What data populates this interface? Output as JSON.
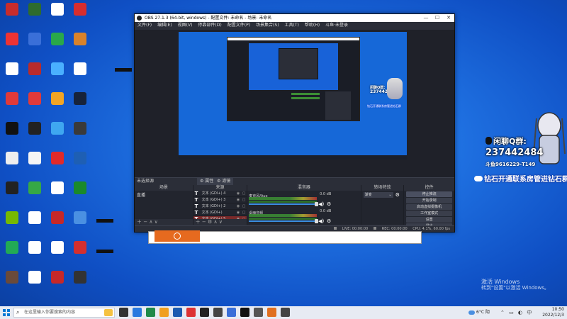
{
  "desktop": {
    "icons": [
      {
        "label": "",
        "color": "#c82c2c",
        "col": 0,
        "row": 0
      },
      {
        "label": "",
        "color": "#2e6b2e",
        "col": 1,
        "row": 0
      },
      {
        "label": "",
        "color": "#ffffff",
        "col": 2,
        "row": 0
      },
      {
        "label": "",
        "color": "#d72d2d",
        "col": 3,
        "row": 0
      },
      {
        "label": "",
        "color": "#e33",
        "col": 0,
        "row": 1
      },
      {
        "label": "",
        "color": "#3a6fd8",
        "col": 1,
        "row": 1
      },
      {
        "label": "",
        "color": "#2aa84a",
        "col": 2,
        "row": 1
      },
      {
        "label": "",
        "color": "#d9822b",
        "col": 3,
        "row": 1
      },
      {
        "label": "",
        "color": "#ffffff",
        "col": 0,
        "row": 2
      },
      {
        "label": "",
        "color": "#b92b2b",
        "col": 1,
        "row": 2
      },
      {
        "label": "",
        "color": "#4ab0ff",
        "col": 2,
        "row": 2
      },
      {
        "label": "",
        "color": "#ffffff",
        "col": 3,
        "row": 2
      },
      {
        "label": "",
        "color": "#e03a3a",
        "col": 0,
        "row": 3
      },
      {
        "label": "",
        "color": "#e03a3a",
        "col": 1,
        "row": 3
      },
      {
        "label": "",
        "color": "#f2a524",
        "col": 2,
        "row": 3
      },
      {
        "label": "",
        "color": "#17233a",
        "col": 3,
        "row": 3
      },
      {
        "label": "",
        "color": "#111111",
        "col": 0,
        "row": 4
      },
      {
        "label": "",
        "color": "#222222",
        "col": 1,
        "row": 4
      },
      {
        "label": "",
        "color": "#3fa7f0",
        "col": 2,
        "row": 4
      },
      {
        "label": "",
        "color": "#3a3a3a",
        "col": 3,
        "row": 4
      },
      {
        "label": "",
        "color": "#eeeeee",
        "col": 0,
        "row": 5
      },
      {
        "label": "",
        "color": "#f5f5f5",
        "col": 1,
        "row": 5
      },
      {
        "label": "",
        "color": "#e02a2a",
        "col": 2,
        "row": 5
      },
      {
        "label": "",
        "color": "#1e5fb4",
        "col": 3,
        "row": 5
      },
      {
        "label": "",
        "color": "#222222",
        "col": 0,
        "row": 6
      },
      {
        "label": "",
        "color": "#36a845",
        "col": 1,
        "row": 6
      },
      {
        "label": "",
        "color": "#ffffff",
        "col": 2,
        "row": 6
      },
      {
        "label": "",
        "color": "#1a8a2a",
        "col": 3,
        "row": 6
      },
      {
        "label": "",
        "color": "#76b900",
        "col": 0,
        "row": 7
      },
      {
        "label": "",
        "color": "#ffffff",
        "col": 1,
        "row": 7
      },
      {
        "label": "",
        "color": "#c62828",
        "col": 2,
        "row": 7
      },
      {
        "label": "",
        "color": "#4a90e2",
        "col": 3,
        "row": 7
      },
      {
        "label": "",
        "color": "#22aa55",
        "col": 0,
        "row": 8
      },
      {
        "label": "",
        "color": "#ffffff",
        "col": 1,
        "row": 8
      },
      {
        "label": "",
        "color": "#ffffff",
        "col": 2,
        "row": 8
      },
      {
        "label": "",
        "color": "#d32f2f",
        "col": 3,
        "row": 8
      },
      {
        "label": "",
        "color": "#6a4a3a",
        "col": 0,
        "row": 9
      },
      {
        "label": "",
        "color": "#ffffff",
        "col": 1,
        "row": 9
      },
      {
        "label": "",
        "color": "#c62828",
        "col": 2,
        "row": 9
      },
      {
        "label": "",
        "color": "#333333",
        "col": 3,
        "row": 9
      }
    ]
  },
  "obs": {
    "title": "OBS 27.1.3 (64-bit, windows) - 配置文件: 未命名 - 场景: 未命名",
    "menu": [
      "文件(F)",
      "编辑(E)",
      "视图(V)",
      "停靠部件(D)",
      "配置文件(P)",
      "场景集合(S)",
      "工具(T)",
      "帮助(H)",
      "斗鱼·未登录"
    ],
    "no_source_label": "未选择源",
    "attr_btn": "⚙ 属性",
    "filter_btn": "⚙ 滤镜",
    "docks": {
      "scenes": "场景",
      "sources": "来源",
      "mixer": "混音器",
      "transitions": "转场特效",
      "controls": "控件"
    },
    "scene_items": [
      "直播"
    ],
    "source_items": [
      "文本 (GDI+) 4",
      "文本 (GDI+) 3",
      "文本 (GDI+) 2",
      "文本 (GDI+)",
      "文本 (GDI+) 5"
    ],
    "mixer_channels": [
      {
        "name": "麦克风/Aux",
        "db": "0.0 dB"
      },
      {
        "name": "桌面音频",
        "db": "0.0 dB"
      }
    ],
    "transition": "渐变",
    "controls": [
      "停止推流",
      "开始录制",
      "启动虚拟摄像机",
      "工作室模式",
      "设置",
      "退出"
    ],
    "status": {
      "live": "LIVE: 00:00:00",
      "rec": "REC: 00:00:00",
      "cpu": "CPU: 4.1%, 60.00 fps"
    }
  },
  "overlay": {
    "qq_label": "闲聊Q群:",
    "qq_number": "237442484",
    "douyu": "斗鱼9616229-T149",
    "banner": "钻石开通联系房管进钻石群"
  },
  "watermark": {
    "line1": "激活 Windows",
    "line2": "转到\"设置\"以激活 Windows。"
  },
  "taskbar": {
    "search_placeholder": "在这里输入你要搜索的内容",
    "weather": "6°C 阴",
    "time": "10:50",
    "date": "2022/12/3",
    "apps": [
      "#333333",
      "#2a7adf",
      "#1f8a4a",
      "#f0a020",
      "#1b5bb0",
      "#d33",
      "#222",
      "#444",
      "#3a6fd8",
      "#111",
      "#555",
      "#e06f1f",
      "#444"
    ]
  }
}
